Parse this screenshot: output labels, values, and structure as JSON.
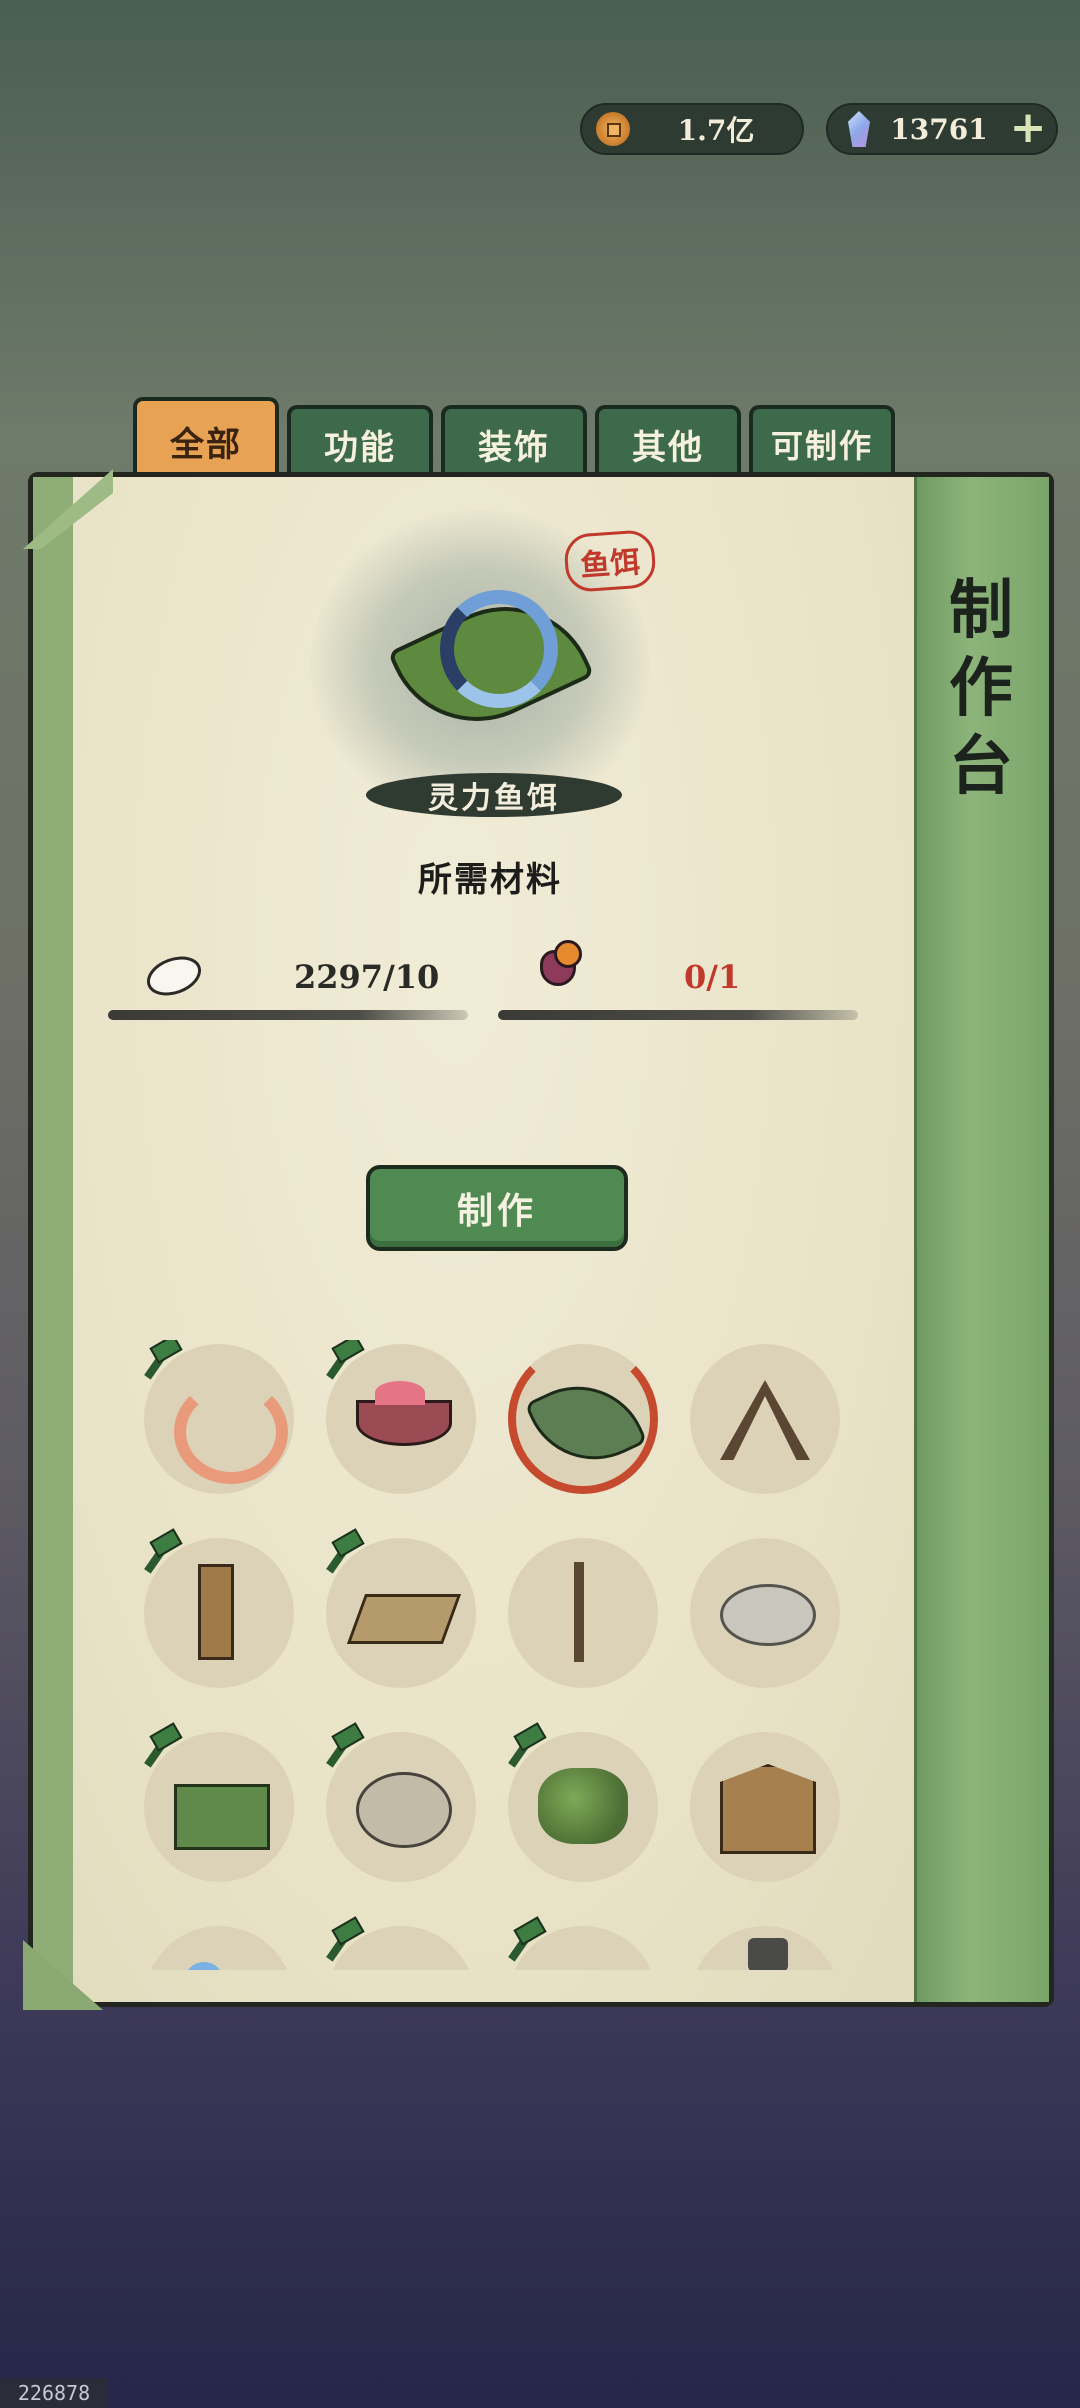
{
  "currency": {
    "coins": "1.7亿",
    "gems": "13761",
    "coin_icon": "copper-coin-icon",
    "gem_icon": "spirit-crystal-icon",
    "add_label": "+"
  },
  "tabs": [
    {
      "label": "全部",
      "active": true
    },
    {
      "label": "功能",
      "active": false
    },
    {
      "label": "装饰",
      "active": false
    },
    {
      "label": "其他",
      "active": false
    },
    {
      "label": "可制作",
      "active": false
    }
  ],
  "panel": {
    "title": "制作台"
  },
  "featured": {
    "category_stamp": "鱼饵",
    "name": "灵力鱼饵",
    "materials_title": "所需材料",
    "materials": [
      {
        "icon": "silk-cocoon-icon",
        "quantity": "2297/10",
        "sufficient": true
      },
      {
        "icon": "spirit-flower-icon",
        "quantity": "0/1",
        "sufficient": false
      }
    ],
    "craft_label": "制作"
  },
  "grid": {
    "items": [
      {
        "icon": "earthworm-icon",
        "craftable": true
      },
      {
        "icon": "bait-bowl-icon",
        "craftable": true
      },
      {
        "icon": "spirit-bait-icon",
        "craftable": false,
        "selected": true
      },
      {
        "icon": "cooking-tripod-icon",
        "craftable": false
      },
      {
        "icon": "scarecrow-icon",
        "craftable": true
      },
      {
        "icon": "bamboo-mat-icon",
        "craftable": true
      },
      {
        "icon": "sign-pole-icon",
        "craftable": false
      },
      {
        "icon": "bagua-platform-icon",
        "craftable": false
      },
      {
        "icon": "green-chest-icon",
        "craftable": true
      },
      {
        "icon": "stone-mill-icon",
        "craftable": true
      },
      {
        "icon": "garden-plot-icon",
        "craftable": true
      },
      {
        "icon": "market-stall-icon",
        "craftable": false
      },
      {
        "icon": "blue-orb-icon",
        "craftable": false
      },
      {
        "icon": "hidden-item-icon",
        "craftable": true
      },
      {
        "icon": "hidden-item-icon",
        "craftable": true
      },
      {
        "icon": "iron-pot-icon",
        "craftable": false
      }
    ]
  },
  "colors": {
    "accent_tab": "#e8a254",
    "tab_green": "#3d6a4a",
    "insufficient_red": "#c0392b",
    "sufficient_dark": "#2a2a26",
    "craft_button": "#4e8a52"
  },
  "footer": {
    "build_id": "226878"
  }
}
